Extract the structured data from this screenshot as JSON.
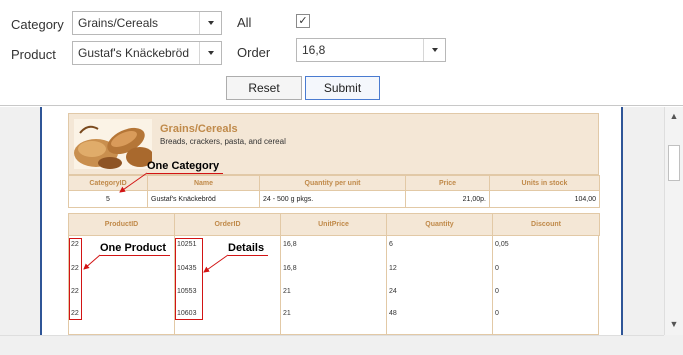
{
  "filter": {
    "category_label": "Category",
    "category_value": "Grains/Cereals",
    "all_label": "All",
    "all_checked": "✓",
    "product_label": "Product",
    "product_value": "Gustaf's Knäckebröd",
    "order_label": "Order",
    "order_value": "16,8",
    "reset_label": "Reset",
    "submit_label": "Submit"
  },
  "report": {
    "category_name": "Grains/Cereals",
    "category_description": "Breads, crackers, pasta, and cereal",
    "category_table": {
      "headers": [
        "CategoryID",
        "Name",
        "Quantity per unit",
        "Price",
        "Units in stock"
      ],
      "row": [
        "5",
        "Gustaf's Knäckebröd",
        "24 - 500 g pkgs.",
        "21,00р.",
        "104,00"
      ]
    },
    "details_table": {
      "headers": [
        "ProductID",
        "OrderID",
        "UnitPrice",
        "Quantity",
        "Discount"
      ],
      "rows": [
        [
          "22",
          "10251",
          "16,8",
          "6",
          "0,05"
        ],
        [
          "22",
          "10435",
          "16,8",
          "12",
          "0"
        ],
        [
          "22",
          "10553",
          "21",
          "24",
          "0"
        ],
        [
          "22",
          "10603",
          "21",
          "48",
          "0"
        ]
      ]
    },
    "annotations": {
      "one_category": "One Category",
      "one_product": "One Product",
      "details": "Details"
    }
  },
  "colors": {
    "band_background": "#f4e7d6",
    "header_text": "#c08a4a",
    "annotation_red": "#d21414",
    "page_border": "#2f5597"
  },
  "icons": {
    "combo_dropdown": "chevron-down-icon",
    "checkbox": "check-icon",
    "scroll_up": "arrow-up-icon",
    "scroll_down": "arrow-down-icon"
  }
}
